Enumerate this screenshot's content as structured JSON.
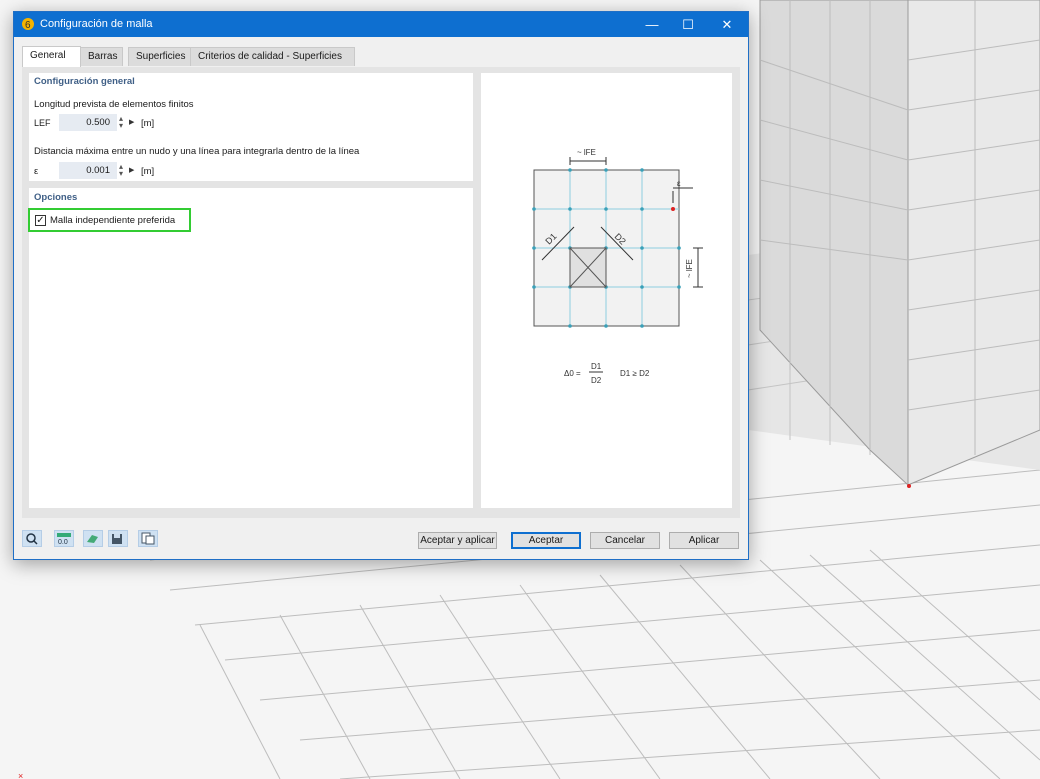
{
  "dialog": {
    "title": "Configuración de malla",
    "tabs": [
      "General",
      "Barras",
      "Superficies",
      "Criterios de calidad - Superficies"
    ],
    "general": {
      "section_title": "Configuración general",
      "fe_length": {
        "label": "Longitud prevista de elementos finitos",
        "symbol": "LEF",
        "value": "0.500",
        "unit": "[m]"
      },
      "max_distance": {
        "label": "Distancia máxima entre un nudo y una línea para integrarla dentro de la línea",
        "symbol": "ε",
        "value": "0.001",
        "unit": "[m]"
      }
    },
    "options": {
      "section_title": "Opciones",
      "preferred_independent_mesh": {
        "label": "Malla independiente preferida",
        "checked": true
      }
    },
    "diagram": {
      "lfe_top": "~ lFE",
      "lfe_side": "~ lFE",
      "epsilon": "ε",
      "d1": "D1",
      "d2": "D2",
      "formula_left": "Δ0 =",
      "frac_num": "D1",
      "frac_den": "D2",
      "formula_right": "D1 ≥ D2"
    },
    "buttons": {
      "accept_apply": "Aceptar y aplicar",
      "accept": "Aceptar",
      "cancel": "Cancelar",
      "apply": "Aplicar"
    },
    "toolbar_icons": [
      "search-help-icon",
      "units-icon",
      "load-icon",
      "save-icon",
      "copy-icon"
    ]
  },
  "colors": {
    "title_bar": "#0e6fd0",
    "highlight": "#33cc33",
    "section_title": "#3f5f86"
  }
}
